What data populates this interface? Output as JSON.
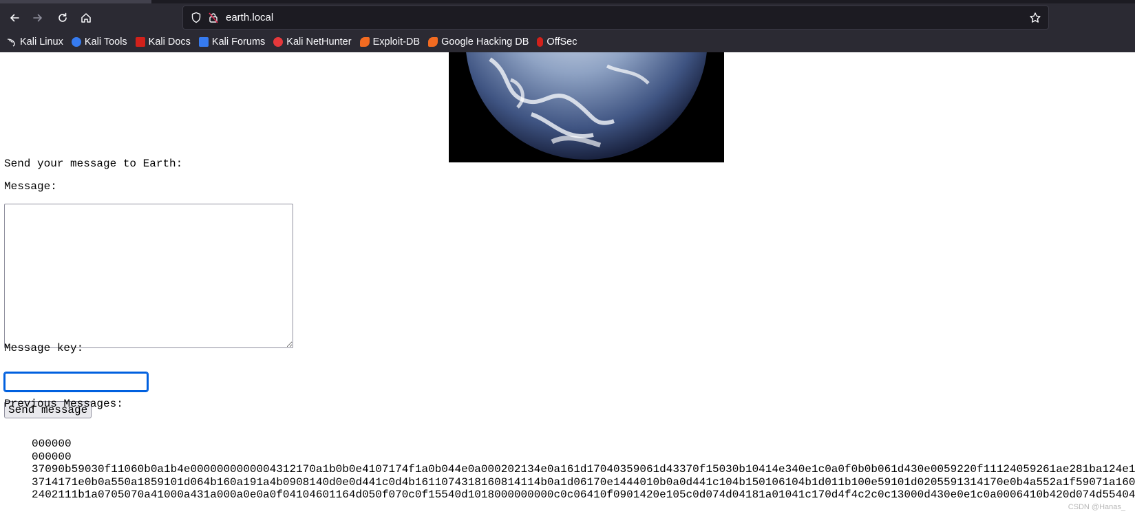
{
  "browser": {
    "url": "earth.local",
    "bookmarks": [
      {
        "label": "Kali Linux",
        "icon": "kali-dragon-icon"
      },
      {
        "label": "Kali Tools",
        "icon": "kali-tools-icon"
      },
      {
        "label": "Kali Docs",
        "icon": "kali-docs-icon"
      },
      {
        "label": "Kali Forums",
        "icon": "kali-forums-icon"
      },
      {
        "label": "Kali NetHunter",
        "icon": "nethunter-icon"
      },
      {
        "label": "Exploit-DB",
        "icon": "exploit-db-icon"
      },
      {
        "label": "Google Hacking DB",
        "icon": "ghdb-icon"
      },
      {
        "label": "OffSec",
        "icon": "offsec-icon"
      }
    ],
    "colors": {
      "toolbar": "#2b2a33",
      "urlbar": "#1c1b22",
      "focus": "#0060df"
    }
  },
  "page": {
    "intro": "Send your message to Earth:",
    "message_label": "Message:",
    "message_value": "",
    "key_label": "Message key:",
    "key_value": "",
    "send_label": "Send message",
    "previous_heading": "Previous Messages:",
    "messages": [
      "000000",
      "000000",
      "37090b59030f11060b0a1b4e0000000000004312170a1b0b0e4107174f1a0b044e0a000202134e0a161d17040359061d43370f15030b10414e340e1c0a0f0b0b061d430e0059220f11124059261ae281ba124e1",
      "3714171e0b0a550a1859101d064b160a191a4b0908140d0e0d441c0d4b1611074318160814114b0a1d06170e1444010b0a0d441c104b150106104b1d011b100e59101d0205591314170e0b4a552a1f59071a160",
      "2402111b1a0705070a41000a431a000a0e0a0f04104601164d050f070c0f15540d1018000000000c0c06410f0901420e105c0d074d04181a01041c170d4f4c2c0c13000d430e0e1c0a0006410b420d074d55404"
    ]
  },
  "watermark": "CSDN @Hanas_"
}
